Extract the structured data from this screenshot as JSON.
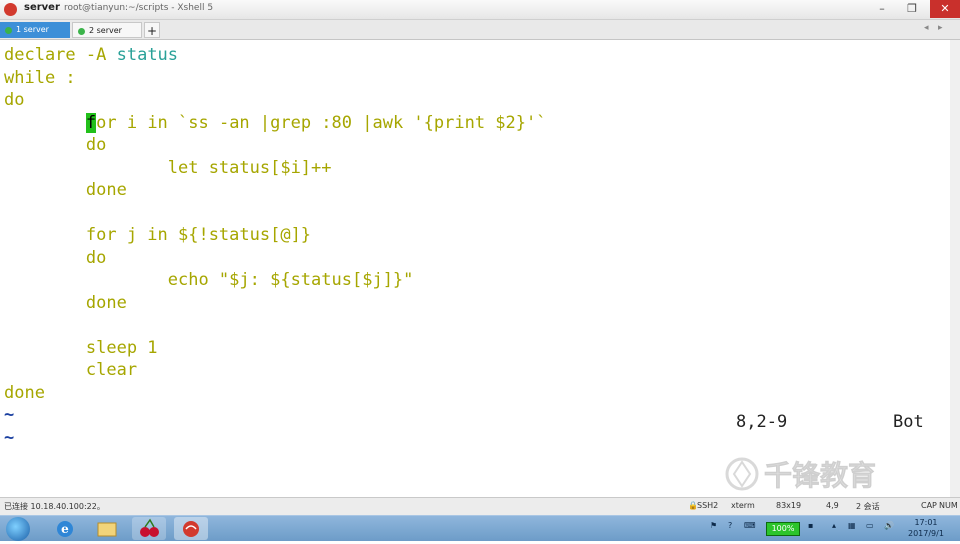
{
  "window": {
    "app_name": "server",
    "title": "root@tianyun:~/scripts - Xshell 5",
    "minimize": "–",
    "maximize": "❐",
    "close": "✕"
  },
  "tabs": [
    {
      "label": "1 server",
      "active": true
    },
    {
      "label": "2 server",
      "active": false
    }
  ],
  "tab_add": "+",
  "tab_nav_left": "◂",
  "tab_nav_right": "▸",
  "terminal": {
    "lines": [
      {
        "segments": [
          {
            "t": "declare ",
            "c": "kw"
          },
          {
            "t": "-A ",
            "c": "kw"
          },
          {
            "t": "status",
            "c": "var"
          }
        ]
      },
      {
        "segments": [
          {
            "t": "while :",
            "c": "kw"
          }
        ]
      },
      {
        "segments": [
          {
            "t": "do",
            "c": "kw"
          }
        ]
      },
      {
        "segments": [
          {
            "t": "        ",
            "c": "kw"
          },
          {
            "t": "f",
            "c": "cursor-char"
          },
          {
            "t": "or i in `ss -an |grep :80 |awk '{print $2}'`",
            "c": "kw"
          }
        ]
      },
      {
        "segments": [
          {
            "t": "        do",
            "c": "kw"
          }
        ]
      },
      {
        "segments": [
          {
            "t": "                let status[$i]++",
            "c": "kw"
          }
        ]
      },
      {
        "segments": [
          {
            "t": "        done",
            "c": "kw"
          }
        ]
      },
      {
        "segments": [
          {
            "t": "",
            "c": "kw"
          }
        ]
      },
      {
        "segments": [
          {
            "t": "        for j in ${!status[@]}",
            "c": "kw"
          }
        ]
      },
      {
        "segments": [
          {
            "t": "        do",
            "c": "kw"
          }
        ]
      },
      {
        "segments": [
          {
            "t": "                echo \"$j: ${status[$j]}\"",
            "c": "kw"
          }
        ]
      },
      {
        "segments": [
          {
            "t": "        done",
            "c": "kw"
          }
        ]
      },
      {
        "segments": [
          {
            "t": "",
            "c": "kw"
          }
        ]
      },
      {
        "segments": [
          {
            "t": "        sleep 1",
            "c": "kw"
          }
        ]
      },
      {
        "segments": [
          {
            "t": "        clear",
            "c": "kw"
          }
        ]
      },
      {
        "segments": [
          {
            "t": "done",
            "c": "kw"
          }
        ]
      },
      {
        "segments": [
          {
            "t": "~",
            "c": "tilde"
          }
        ]
      },
      {
        "segments": [
          {
            "t": "~",
            "c": "tilde"
          }
        ]
      }
    ],
    "cursor_position": "8,2-9",
    "scroll_status": "Bot"
  },
  "watermark_text": "千锋教育",
  "statusbar": {
    "connection": "已连接 10.18.40.100:22。",
    "protocol": "SSH2",
    "terminal_type": "xterm",
    "size": "83x19",
    "cursor": "4,9",
    "sessions": "2 会话",
    "caps": "CAP",
    "num": "NUM"
  },
  "taskbar": {
    "battery": "100%",
    "time": "17:01",
    "date": "2017/9/1"
  },
  "colors": {
    "keyword": "#a6a600",
    "variable": "#2aa198",
    "cursor": "#22c01a",
    "tab_active": "#3c8fd8"
  }
}
